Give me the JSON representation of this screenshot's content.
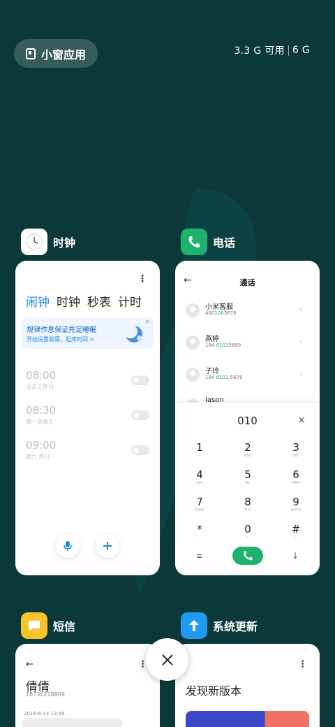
{
  "top": {
    "floating_windows_label": "小窗应用",
    "memory_available": "3.3 G 可用",
    "memory_total": "6 G"
  },
  "clock": {
    "app_name": "时钟",
    "tabs": [
      "闹钟",
      "计时",
      "秒表",
      "计时"
    ],
    "tab_labels": {
      "alarm": "闹钟",
      "clock": "时钟",
      "stopwatch": "秒表",
      "timer": "计时"
    },
    "banner_title": "规律作息保证充足睡眠",
    "banner_sub": "开始设置就寝、起床时间 >",
    "alarms": [
      {
        "time": "08:00",
        "sub": "法定工作日"
      },
      {
        "time": "08:30",
        "sub": "周一至周五"
      },
      {
        "time": "09:00",
        "sub": "周六 周日"
      }
    ]
  },
  "phone": {
    "app_name": "电话",
    "title": "通话",
    "contacts": [
      {
        "name": "小米客服",
        "num_pre": "400",
        "num_hl": "100",
        "num_post": "5678"
      },
      {
        "name": "燕婷",
        "num_pre": "184 ",
        "num_hl": "0101",
        "num_post": "5689"
      },
      {
        "name": "子玲",
        "num_pre": "184 ",
        "num_hl": "0101",
        "num_post": " 5678"
      },
      {
        "name": "Jason",
        "num_pre": "",
        "num_hl": "",
        "num_post": ""
      }
    ],
    "dial_input": "010",
    "keys": [
      {
        "d": "1",
        "l": "—"
      },
      {
        "d": "2",
        "l": "ABC"
      },
      {
        "d": "3",
        "l": "DEF"
      },
      {
        "d": "4",
        "l": "GHI"
      },
      {
        "d": "5",
        "l": "JKL"
      },
      {
        "d": "6",
        "l": "MNO"
      },
      {
        "d": "7",
        "l": "PQRS"
      },
      {
        "d": "8",
        "l": "TUV"
      },
      {
        "d": "9",
        "l": "WXYZ"
      },
      {
        "d": "*",
        "l": ","
      },
      {
        "d": "0",
        "l": "+"
      },
      {
        "d": "#",
        "l": ";"
      }
    ]
  },
  "sms": {
    "app_name": "短信",
    "contact_name": "倩倩",
    "contact_number": "18730218809",
    "date": "2016-6-13 13:49"
  },
  "update": {
    "app_name": "系统更新",
    "title": "发现新版本"
  },
  "colors": {
    "background": "#0b393a",
    "accent_blue": "#1e88e5",
    "phone_green": "#1db36c",
    "sms_yellow": "#f6c32a",
    "update_blue": "#1e9bf0"
  }
}
